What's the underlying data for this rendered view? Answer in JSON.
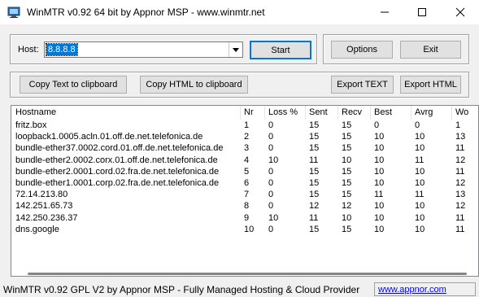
{
  "window": {
    "title": "WinMTR v0.92 64 bit by Appnor MSP - www.winmtr.net",
    "icon": "winmtr-app-icon"
  },
  "host": {
    "label": "Host:",
    "value": "8.8.8.8"
  },
  "buttons": {
    "start": "Start",
    "options": "Options",
    "exit": "Exit",
    "copy_text": "Copy Text to clipboard",
    "copy_html": "Copy HTML to clipboard",
    "export_text": "Export TEXT",
    "export_html": "Export HTML"
  },
  "table": {
    "columns": [
      "Hostname",
      "Nr",
      "Loss %",
      "Sent",
      "Recv",
      "Best",
      "Avrg",
      "Wo"
    ],
    "rows": [
      [
        "fritz.box",
        "1",
        "0",
        "15",
        "15",
        "0",
        "0",
        "1"
      ],
      [
        "loopback1.0005.acln.01.off.de.net.telefonica.de",
        "2",
        "0",
        "15",
        "15",
        "10",
        "10",
        "13"
      ],
      [
        "bundle-ether37.0002.cord.01.off.de.net.telefonica.de",
        "3",
        "0",
        "15",
        "15",
        "10",
        "10",
        "11"
      ],
      [
        "bundle-ether2.0002.corx.01.off.de.net.telefonica.de",
        "4",
        "10",
        "11",
        "10",
        "10",
        "11",
        "12"
      ],
      [
        "bundle-ether2.0001.cord.02.fra.de.net.telefonica.de",
        "5",
        "0",
        "15",
        "15",
        "10",
        "10",
        "11"
      ],
      [
        "bundle-ether1.0001.corp.02.fra.de.net.telefonica.de",
        "6",
        "0",
        "15",
        "15",
        "10",
        "10",
        "12"
      ],
      [
        "72.14.213.80",
        "7",
        "0",
        "15",
        "15",
        "11",
        "11",
        "13"
      ],
      [
        "142.251.65.73",
        "8",
        "0",
        "12",
        "12",
        "10",
        "10",
        "12"
      ],
      [
        "142.250.236.37",
        "9",
        "10",
        "11",
        "10",
        "10",
        "10",
        "11"
      ],
      [
        "dns.google",
        "10",
        "0",
        "15",
        "15",
        "10",
        "10",
        "11"
      ]
    ]
  },
  "status": {
    "text": "WinMTR v0.92 GPL V2 by Appnor MSP - Fully Managed Hosting & Cloud Provider",
    "link": "www.appnor.com"
  }
}
